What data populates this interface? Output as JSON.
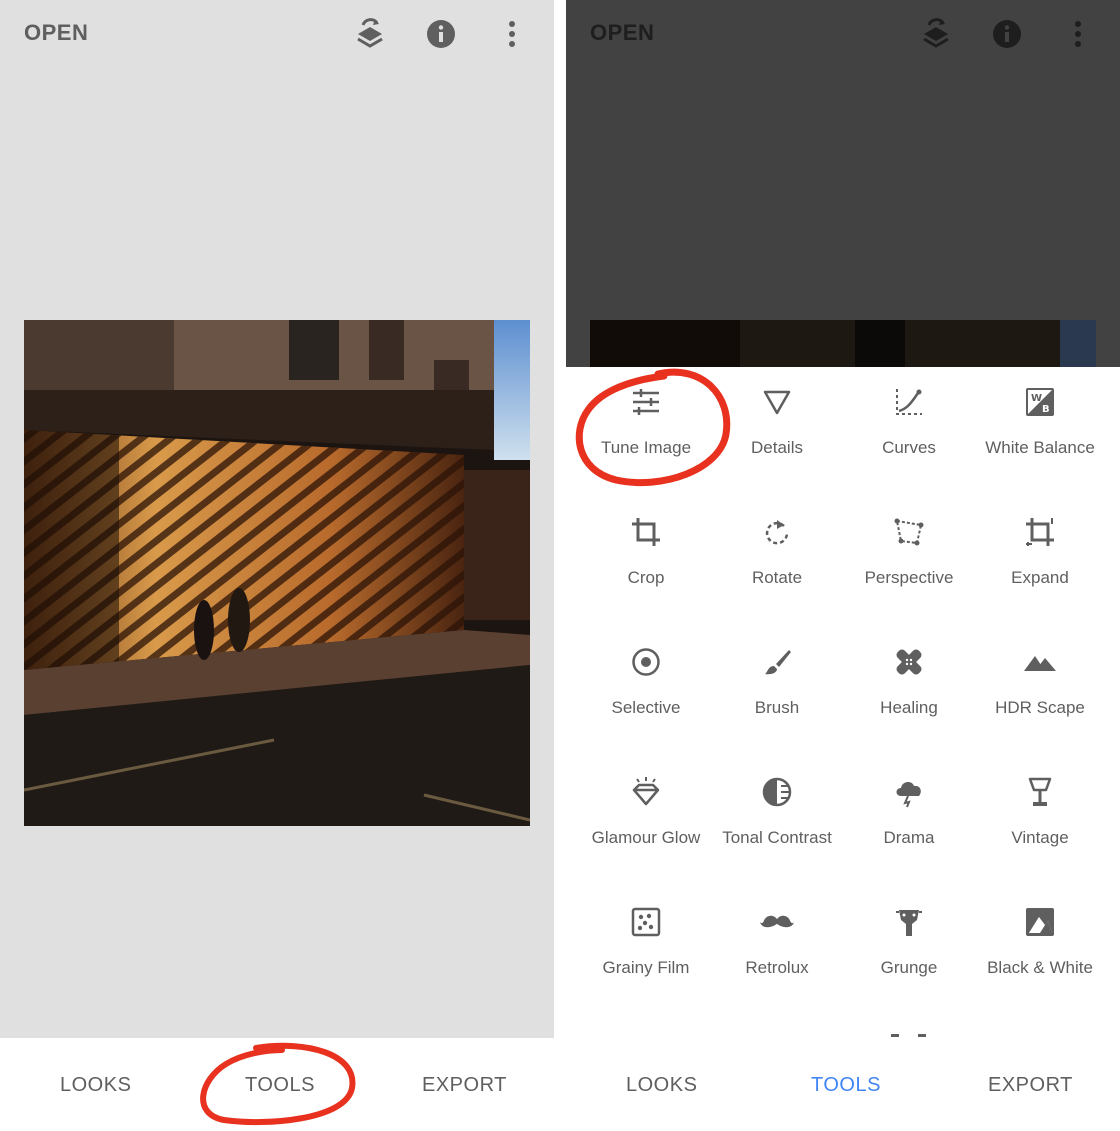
{
  "left": {
    "open_label": "OPEN",
    "tabs": {
      "looks": "LOOKS",
      "tools": "TOOLS",
      "export": "EXPORT"
    }
  },
  "right": {
    "open_label": "OPEN",
    "tabs": {
      "looks": "LOOKS",
      "tools": "TOOLS",
      "export": "EXPORT",
      "active": "tools"
    },
    "tools": [
      {
        "label": "Tune Image",
        "icon": "tune-icon"
      },
      {
        "label": "Details",
        "icon": "details-triangle-icon"
      },
      {
        "label": "Curves",
        "icon": "curves-icon"
      },
      {
        "label": "White Balance",
        "icon": "white-balance-icon"
      },
      {
        "label": "Crop",
        "icon": "crop-icon"
      },
      {
        "label": "Rotate",
        "icon": "rotate-icon"
      },
      {
        "label": "Perspective",
        "icon": "perspective-icon"
      },
      {
        "label": "Expand",
        "icon": "expand-icon"
      },
      {
        "label": "Selective",
        "icon": "selective-icon"
      },
      {
        "label": "Brush",
        "icon": "brush-icon"
      },
      {
        "label": "Healing",
        "icon": "healing-icon"
      },
      {
        "label": "HDR Scape",
        "icon": "mountains-icon"
      },
      {
        "label": "Glamour Glow",
        "icon": "diamond-icon"
      },
      {
        "label": "Tonal Contrast",
        "icon": "tonal-contrast-icon"
      },
      {
        "label": "Drama",
        "icon": "cloud-lightning-icon"
      },
      {
        "label": "Vintage",
        "icon": "lamp-icon"
      },
      {
        "label": "Grainy Film",
        "icon": "film-grain-icon"
      },
      {
        "label": "Retrolux",
        "icon": "mustache-icon"
      },
      {
        "label": "Grunge",
        "icon": "grunge-guitar-icon"
      },
      {
        "label": "Black & White",
        "icon": "black-white-icon"
      }
    ]
  },
  "colors": {
    "accent_blue": "#4285f4",
    "highlight_red": "#e8321f",
    "text_gray": "#5f5f5f",
    "canvas_gray": "#e0e0e0",
    "dim_gray": "#424242"
  }
}
